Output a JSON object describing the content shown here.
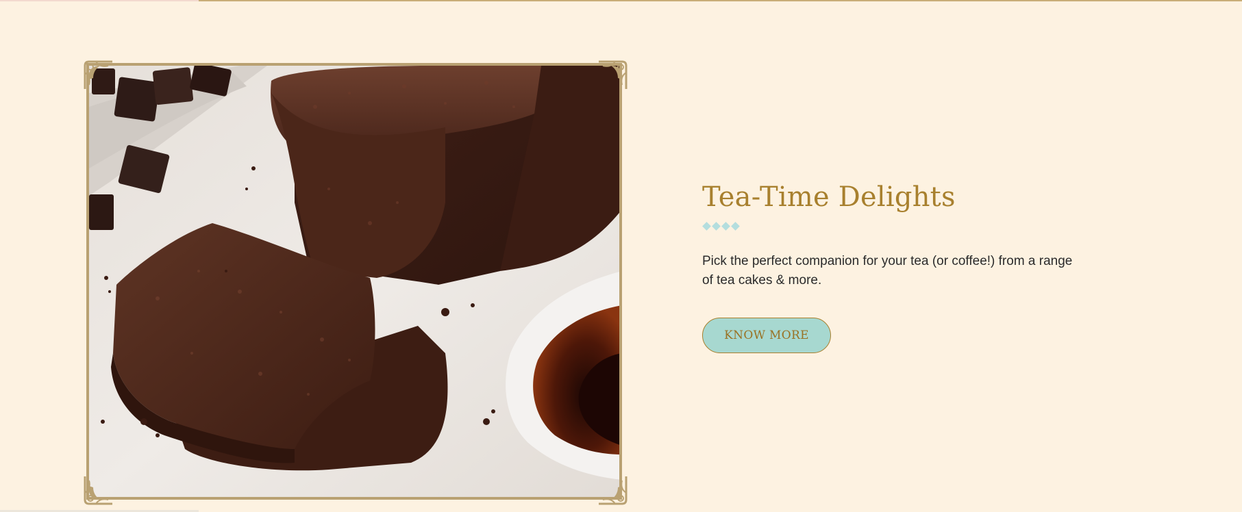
{
  "feature": {
    "title": "Tea-Time Delights",
    "description": "Pick the perfect companion for your tea (or coffee!) from a range of tea cakes & more.",
    "cta_label": "KNOW MORE"
  },
  "colors": {
    "background": "#fdf2e1",
    "title": "#a8802e",
    "divider": "#b4dede",
    "button_bg": "#a7d8d0",
    "frame": "#b9a172"
  },
  "icons": {
    "divider": "diamond-row-icon",
    "corner": "ornate-corner-icon"
  },
  "image": {
    "subject": "chocolate-loaf-cake-photo"
  }
}
